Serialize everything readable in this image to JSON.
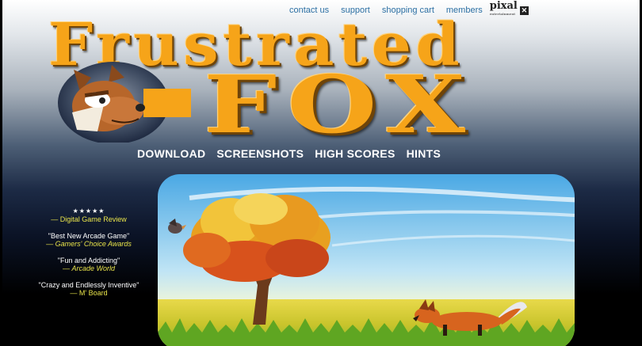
{
  "top_nav": {
    "links": [
      "contact us",
      "support",
      "shopping cart",
      "members"
    ],
    "logo_text": "pixal",
    "logo_subtext": "entertainment"
  },
  "title": {
    "line1": "Frustrated",
    "line2": "FOX"
  },
  "main_nav": [
    "DOWNLOAD",
    "SCREENSHOTS",
    "HIGH SCORES",
    "HINTS"
  ],
  "reviews": [
    {
      "stars": "★★★★★",
      "quote": "",
      "source": "— Digital Game Review"
    },
    {
      "stars": "",
      "quote": "\"Best New Arcade Game\"",
      "source_prefix": "— ",
      "source": "Gamers' Choice Awards"
    },
    {
      "stars": "",
      "quote": "\"Fun and Addicting\"",
      "source_prefix": "— ",
      "source": "Arcade World"
    },
    {
      "stars": "",
      "quote": "\"Crazy and Endlessly Inventive\"",
      "source_prefix": "",
      "source": "— M' Board"
    }
  ],
  "colors": {
    "title_orange": "#f6a419",
    "link_blue": "#2b6fa3",
    "review_yellow": "#e8e34a"
  },
  "icons": [
    "fox-mascot-icon",
    "fox-running-icon",
    "bird-icon",
    "autumn-tree-icon"
  ]
}
